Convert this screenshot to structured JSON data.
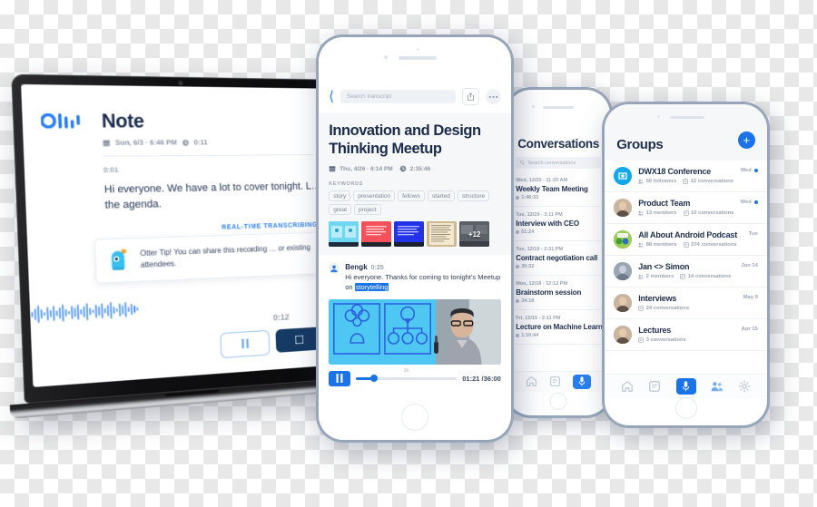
{
  "laptop": {
    "logo_name": "otter-logo",
    "note": {
      "title": "Note",
      "date": "Sun, 6/3 · 6:46 PM",
      "duration": "0:11",
      "stamp": "0:01",
      "transcript": "Hi everyone. We have a lot to cover tonight. L… the agenda.",
      "realtime_label": "REAL-TIME TRANSCRIBING",
      "tip_text": "Otter Tip! You can share this recording … or existing attendees.",
      "wave_time": "0:12",
      "pause_label": "pause-button",
      "stop_label": "stop-button"
    }
  },
  "phone_conversations": {
    "title": "Conversations",
    "search_placeholder": "Search conversations",
    "items": [
      {
        "date": "Wed, 12/20 - 11:20 AM",
        "name": "Weekly Team Meeting",
        "duration": "1:48:33"
      },
      {
        "date": "Tue, 12/19 - 3:11 PM",
        "name": "Interview with CEO",
        "duration": "51:24"
      },
      {
        "date": "Tue, 12/19 - 2:31 PM",
        "name": "Contract negotiation call",
        "duration": "30:32"
      },
      {
        "date": "Mon, 12/18 - 12:12 PM",
        "name": "Brainstorm session",
        "duration": "34:18"
      },
      {
        "date": "Fri, 12/15 - 2:11 PM",
        "name": "Lecture on Machine Learning",
        "duration": "1:10:44"
      }
    ],
    "tabs": [
      "home-icon",
      "notes-icon",
      "record-icon"
    ]
  },
  "phone_transcript": {
    "search_placeholder": "Search transcript",
    "back_icon": "back-chevron-icon",
    "share_icon": "share-icon",
    "more_icon": "more-options-icon",
    "title": "Innovation and Design Thinking Meetup",
    "date": "Thu, 4/26 · 6:14 PM",
    "duration": "2:35:46",
    "keywords_label": "KEYWORDS",
    "keywords": [
      "story",
      "presentation",
      "fellows",
      "started",
      "structure",
      "great",
      "project"
    ],
    "thumbnails_more": "+12",
    "speaker": {
      "name": "Bengk",
      "time": "0:25",
      "text_before": "Hi everyone. Thanks for coming to tonight’s Meetup on ",
      "highlight": "storytelling"
    },
    "player": {
      "state_icon": "pause-icon",
      "speed": "2x",
      "time": "01:21 /36:00"
    }
  },
  "phone_groups": {
    "title": "Groups",
    "add_label": "+",
    "items": [
      {
        "name": "DWX18 Conference",
        "members": "66 followers",
        "conversations": "12 conversations",
        "when": "Wed",
        "unread": true
      },
      {
        "name": "Product Team",
        "members": "13 members",
        "conversations": "10 conversations",
        "when": "Wed",
        "unread": true
      },
      {
        "name": "All About Android Podcast",
        "members": "88 members",
        "conversations": "374 conversations",
        "when": "Tue",
        "unread": false
      },
      {
        "name": "Jan <> Simon",
        "members": "2 members",
        "conversations": "14 conversations",
        "when": "Jun 14",
        "unread": false
      },
      {
        "name": "Interviews",
        "members": "",
        "conversations": "24 conversations",
        "when": "May 9",
        "unread": false
      },
      {
        "name": "Lectures",
        "members": "",
        "conversations": "3 conversations",
        "when": "Apr 15",
        "unread": false
      }
    ],
    "tabs": [
      "home-icon",
      "notes-icon",
      "record-icon",
      "groups-icon",
      "settings-icon"
    ]
  },
  "colors": {
    "accent": "#1a73e8",
    "logo_blue": "#2a7ff0",
    "title_navy": "#20304f",
    "muted": "#9aa4b4",
    "phone_frame": "#96a5ba",
    "sheet_bg": "#f6f7f9"
  }
}
